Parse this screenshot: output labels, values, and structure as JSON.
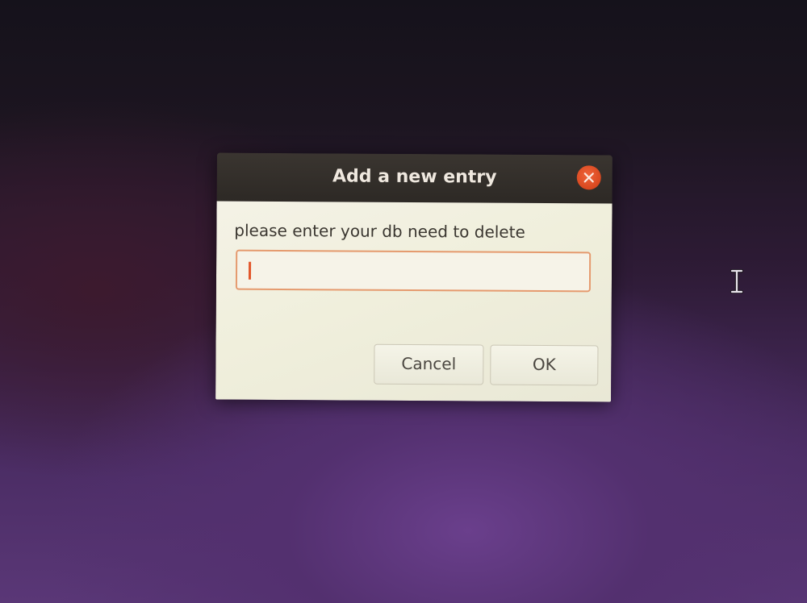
{
  "dialog": {
    "title": "Add a new entry",
    "prompt": "please enter your db need to delete",
    "entry": {
      "value": "",
      "placeholder": ""
    },
    "buttons": {
      "cancel_label": "Cancel",
      "ok_label": "OK"
    },
    "close_icon": "close-icon"
  },
  "pointer": {
    "icon": "ibeam-cursor-icon"
  },
  "colors": {
    "accent": "#e2562a",
    "close_button": "#d8481f",
    "titlebar": "#2d2925",
    "dialog_body": "#f0efdc",
    "entry_border": "#e59a6e",
    "desktop_purple": "#5a3777"
  }
}
